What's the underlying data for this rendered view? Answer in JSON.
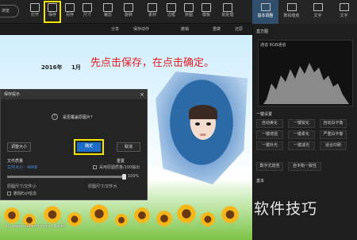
{
  "toolbar": {
    "first_label": "浏览",
    "buttons": [
      {
        "label": "打开",
        "icon": "folder-icon"
      },
      {
        "label": "保存",
        "icon": "save-icon",
        "highlighted": true
      },
      {
        "label": "另存",
        "icon": "save-as-icon"
      },
      {
        "label": "尺寸",
        "icon": "resize-icon"
      },
      {
        "label": "裁剪",
        "icon": "crop-icon"
      },
      {
        "label": "旋转",
        "icon": "rotate-icon"
      },
      {
        "label": "素材",
        "icon": "material-icon"
      },
      {
        "label": "边框",
        "icon": "frame-icon"
      },
      {
        "label": "拼图",
        "icon": "collage-icon"
      },
      {
        "label": "模板",
        "icon": "template-icon"
      },
      {
        "label": "批处理",
        "icon": "batch-icon"
      }
    ]
  },
  "subbar": {
    "share": "分享",
    "save_action": "保存动作",
    "undo": "撤销",
    "redo": "重做",
    "restore": "还原"
  },
  "right_tabs": [
    {
      "label": "基本调整",
      "icon": "adjust-icon",
      "active": true
    },
    {
      "label": "数码暗房",
      "icon": "camera-icon"
    },
    {
      "label": "文字",
      "icon": "text-icon"
    },
    {
      "label": "文字",
      "icon": "text-t-icon"
    }
  ],
  "canvas": {
    "year": "2016年",
    "month": "1月",
    "annotation": "先点击保存，在点击确定。",
    "watermark": "by www.nalbcom.com | Natch"
  },
  "dialog": {
    "title": "保存提示",
    "message": "是否覆盖原图片？",
    "ok": "确定",
    "cancel": "取消",
    "size_button": "调整大小",
    "file_quality_label": "文件质量",
    "file_size_label": "文件大小：40KB",
    "reset": "重置",
    "original_quality": "采用原图质量/100输出",
    "quality_value": "100%",
    "quality_level": 1.0,
    "orig_size_label": "原图尺寸/文件小",
    "new_size_label": "原图尺寸/文件大",
    "keep_exif": "删除Exif信息"
  },
  "right_panel": {
    "histogram_head": "直方图",
    "channel": "通道",
    "channel_value": "RGB通道",
    "one_click_head": "一键设置",
    "buttons": [
      "自动美化",
      "一键锐化",
      "自动白平衡",
      "一键增强",
      "一键柔化",
      "严重白平衡",
      "一键补光",
      "一键减光",
      "适合印刷",
      "数字式增亮",
      "自平衡一致性"
    ],
    "basic_head": "基本"
  },
  "brand": "软件技巧",
  "colors": {
    "accent": "#1d6cc6",
    "highlight": "#f2e600",
    "annotation": "#e51c23",
    "active_tab": "#2f4f6c"
  }
}
